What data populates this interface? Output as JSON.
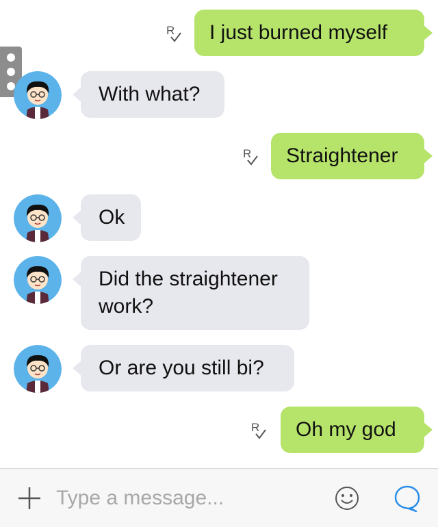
{
  "colors": {
    "outgoing_bubble": "#b6e36a",
    "incoming_bubble": "#e7e7ee",
    "accent": "#2a8ee8",
    "avatar_bg": "#5cb3ea"
  },
  "messages": [
    {
      "direction": "outgoing",
      "text": "I just burned myself",
      "status_icon": "read-receipt-icon"
    },
    {
      "direction": "incoming",
      "text": "With what?",
      "avatar_icon": "cartoon-avatar-icon"
    },
    {
      "direction": "outgoing",
      "text": "Straightener",
      "status_icon": "read-receipt-icon"
    },
    {
      "direction": "incoming",
      "text": "Ok",
      "avatar_icon": "cartoon-avatar-icon"
    },
    {
      "direction": "incoming",
      "text": "Did the straightener work?",
      "avatar_icon": "cartoon-avatar-icon"
    },
    {
      "direction": "incoming",
      "text": "Or are you still bi?",
      "avatar_icon": "cartoon-avatar-icon"
    },
    {
      "direction": "outgoing",
      "text": "Oh my god",
      "status_icon": "read-receipt-icon"
    }
  ],
  "side_handle": {
    "icon": "vertical-dots-icon"
  },
  "composer": {
    "add_icon": "plus-icon",
    "placeholder": "Type a message...",
    "emoji_icon": "smiley-icon",
    "send_icon": "speech-bubble-icon"
  }
}
